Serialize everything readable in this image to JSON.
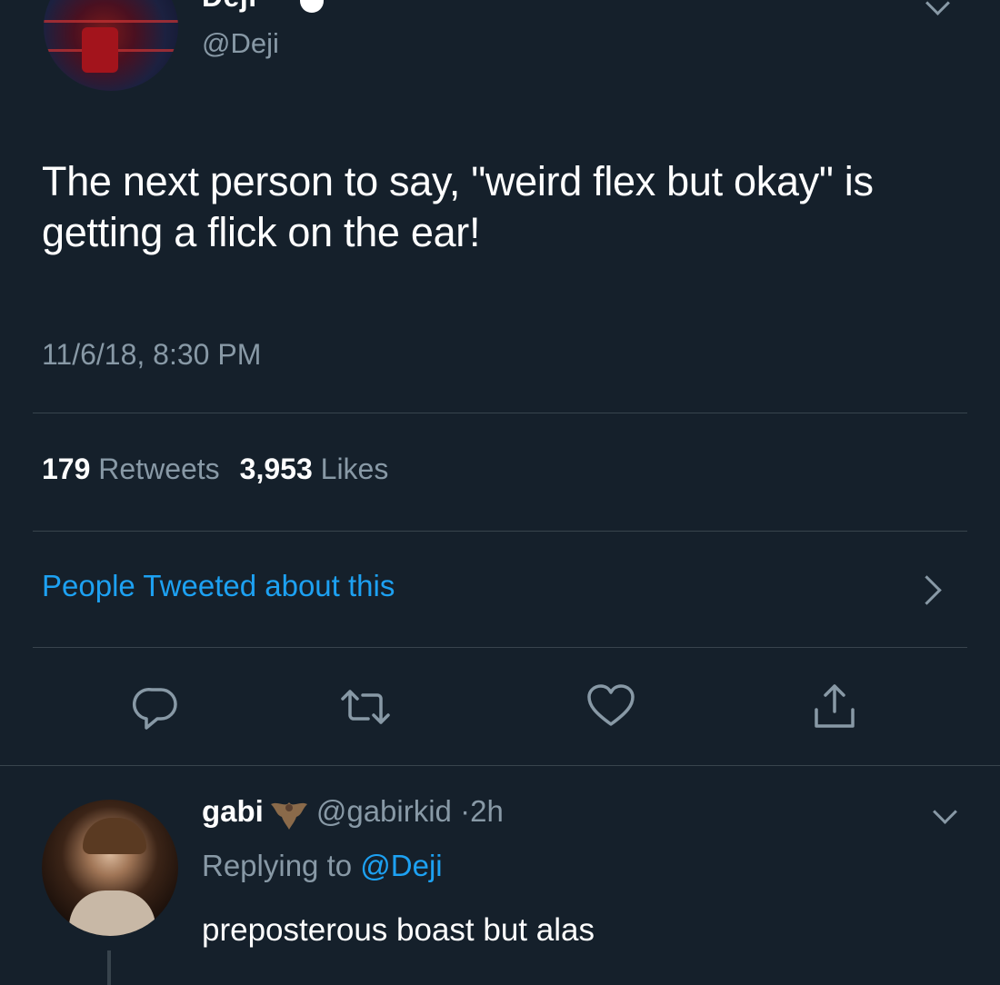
{
  "main_tweet": {
    "author_name": "Deji",
    "handle": "@Deji",
    "text": "The next person to say, \"weird flex but okay\" is getting a flick on the ear!",
    "timestamp": "11/6/18, 8:30 PM",
    "retweets_count": "179",
    "retweets_label": "Retweets",
    "likes_count": "3,953",
    "likes_label": "Likes",
    "people_tweeted_label": "People Tweeted about this"
  },
  "actions": [
    {
      "icon": "reply-icon"
    },
    {
      "icon": "retweet-icon"
    },
    {
      "icon": "like-icon"
    },
    {
      "icon": "share-icon"
    }
  ],
  "reply": {
    "author_name": "gabi",
    "handle": "@gabirkid",
    "separator": "·",
    "time_ago": "2h",
    "replying_prefix": "Replying to",
    "replying_mention": "@Deji",
    "text": "preposterous boast but alas"
  },
  "colors": {
    "background": "#15202b",
    "primary_text": "#ffffff",
    "secondary_text": "#8899a6",
    "link": "#1da1f2",
    "divider": "#38444d"
  }
}
